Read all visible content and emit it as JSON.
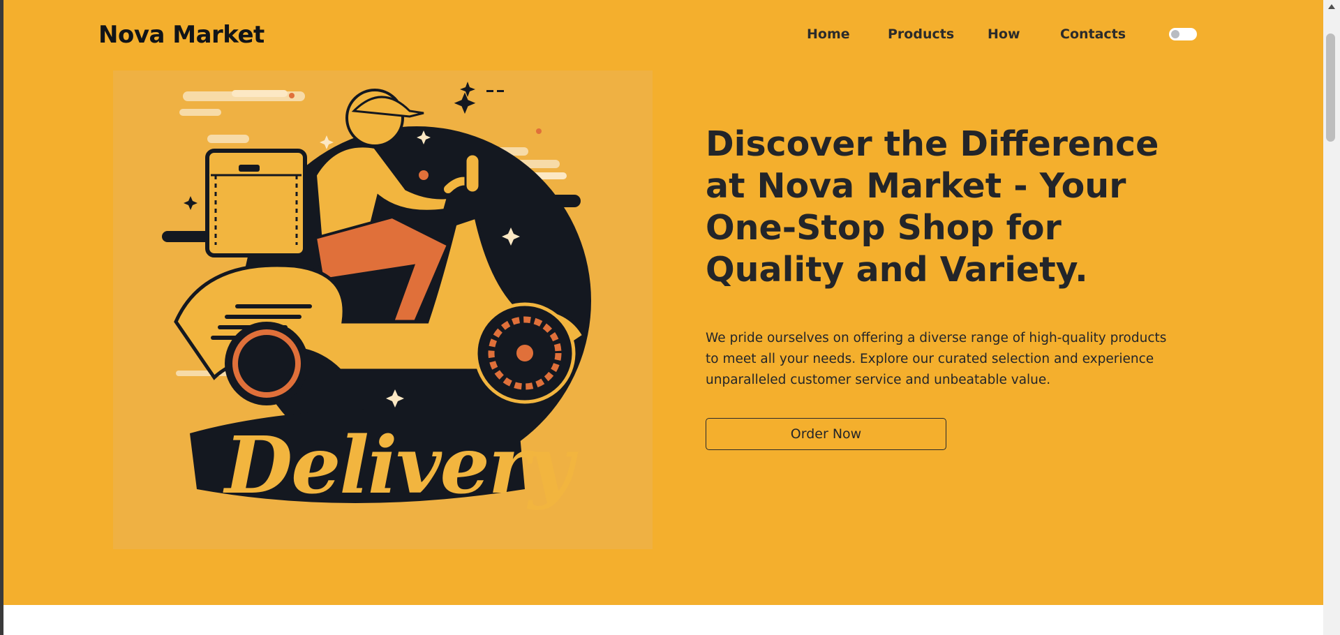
{
  "header": {
    "brand": "Nova Market",
    "nav": [
      "Home",
      "Products",
      "How",
      "Contacts"
    ],
    "theme_toggle_on": false
  },
  "hero": {
    "image_text": "Delivery",
    "headline": "Discover the Difference at Nova Market - Your One-Stop Shop for Quality and Variety.",
    "description": "We pride ourselves on offering a diverse range of high-quality products to meet all your needs. Explore our curated selection and experience unparalleled customer service and unbeatable value.",
    "cta_label": "Order Now"
  },
  "colors": {
    "hero_bg": "#f4af2d",
    "image_bg": "#efb143",
    "dark": "#141820",
    "accent_orange": "#e0703a",
    "accent_yellow": "#f2b53f"
  }
}
